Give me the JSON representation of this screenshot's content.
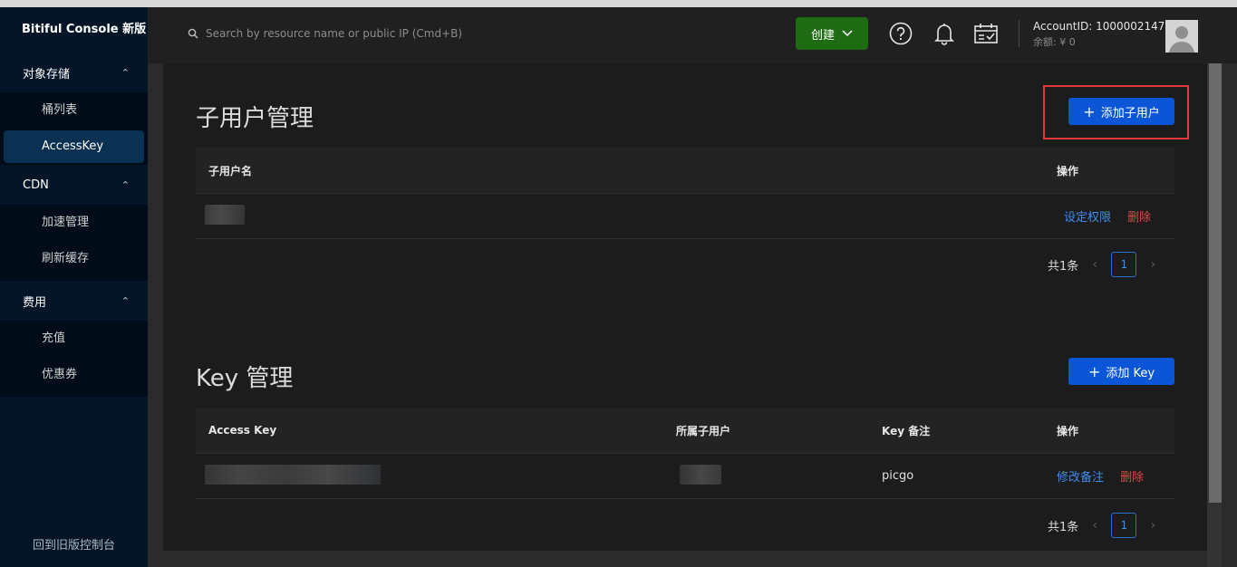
{
  "sidebar": {
    "brand": "Bitiful Console 新版",
    "groups": [
      {
        "label": "对象存储",
        "items": [
          "桶列表",
          "AccessKey"
        ]
      },
      {
        "label": "CDN",
        "items": [
          "加速管理",
          "刷新缓存"
        ]
      },
      {
        "label": "费用",
        "items": [
          "充值",
          "优惠券"
        ]
      }
    ],
    "active_item": "AccessKey",
    "back_old": "回到旧版控制台"
  },
  "topbar": {
    "search_placeholder": "Search by resource name or public IP (Cmd+B)",
    "create_label": "创建",
    "account_id": "AccountID: 1000002147",
    "balance": "余额: ¥ 0"
  },
  "subusers": {
    "title": "子用户管理",
    "add_label": "添加子用户",
    "columns": [
      "子用户名",
      "操作"
    ],
    "row_actions": {
      "edit": "设定权限",
      "delete": "删除"
    },
    "total": "共1条",
    "page": "1"
  },
  "keys": {
    "title": "Key 管理",
    "add_label": "添加 Key",
    "columns": [
      "Access Key",
      "所属子用户",
      "Key 备注",
      "操作"
    ],
    "rows": [
      {
        "note": "picgo"
      }
    ],
    "row_actions": {
      "edit": "修改备注",
      "delete": "删除"
    },
    "total": "共1条",
    "page": "1"
  },
  "colors": {
    "sidebar_bg": "#041527",
    "primary": "#0a56d6",
    "create_green": "#1f6b14",
    "danger": "#e64545",
    "link": "#3f8cf0",
    "highlight_border": "#e03a3a"
  }
}
